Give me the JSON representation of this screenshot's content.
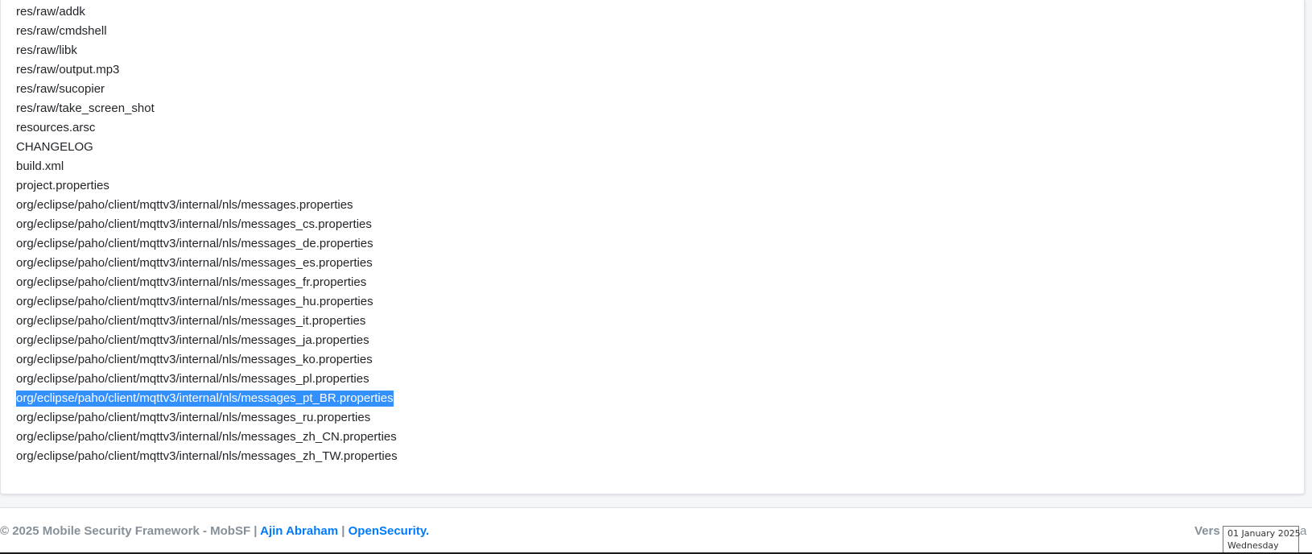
{
  "files": [
    "res/raw/addk",
    "res/raw/cmdshell",
    "res/raw/libk",
    "res/raw/output.mp3",
    "res/raw/sucopier",
    "res/raw/take_screen_shot",
    "resources.arsc",
    "CHANGELOG",
    "build.xml",
    "project.properties",
    "org/eclipse/paho/client/mqttv3/internal/nls/messages.properties",
    "org/eclipse/paho/client/mqttv3/internal/nls/messages_cs.properties",
    "org/eclipse/paho/client/mqttv3/internal/nls/messages_de.properties",
    "org/eclipse/paho/client/mqttv3/internal/nls/messages_es.properties",
    "org/eclipse/paho/client/mqttv3/internal/nls/messages_fr.properties",
    "org/eclipse/paho/client/mqttv3/internal/nls/messages_hu.properties",
    "org/eclipse/paho/client/mqttv3/internal/nls/messages_it.properties",
    "org/eclipse/paho/client/mqttv3/internal/nls/messages_ja.properties",
    "org/eclipse/paho/client/mqttv3/internal/nls/messages_ko.properties",
    "org/eclipse/paho/client/mqttv3/internal/nls/messages_pl.properties",
    "org/eclipse/paho/client/mqttv3/internal/nls/messages_pt_BR.properties",
    "org/eclipse/paho/client/mqttv3/internal/nls/messages_ru.properties",
    "org/eclipse/paho/client/mqttv3/internal/nls/messages_zh_CN.properties",
    "org/eclipse/paho/client/mqttv3/internal/nls/messages_zh_TW.properties"
  ],
  "selected_file": "org/eclipse/paho/client/mqttv3/internal/nls/messages_pt_BR.properties",
  "footer": {
    "copyright": "© 2025 Mobile Security Framework - MobSF |",
    "author_link": "Ajin Abraham",
    "separator": "|",
    "org_link": "OpenSecurity.",
    "version_prefix": "Vers",
    "version_tail": "a"
  },
  "tooltip": {
    "date": "01 January 2025",
    "weekday": "Wednesday"
  },
  "colors": {
    "link": "#007bff",
    "selection": "#3390ff",
    "muted_text": "#869099"
  }
}
